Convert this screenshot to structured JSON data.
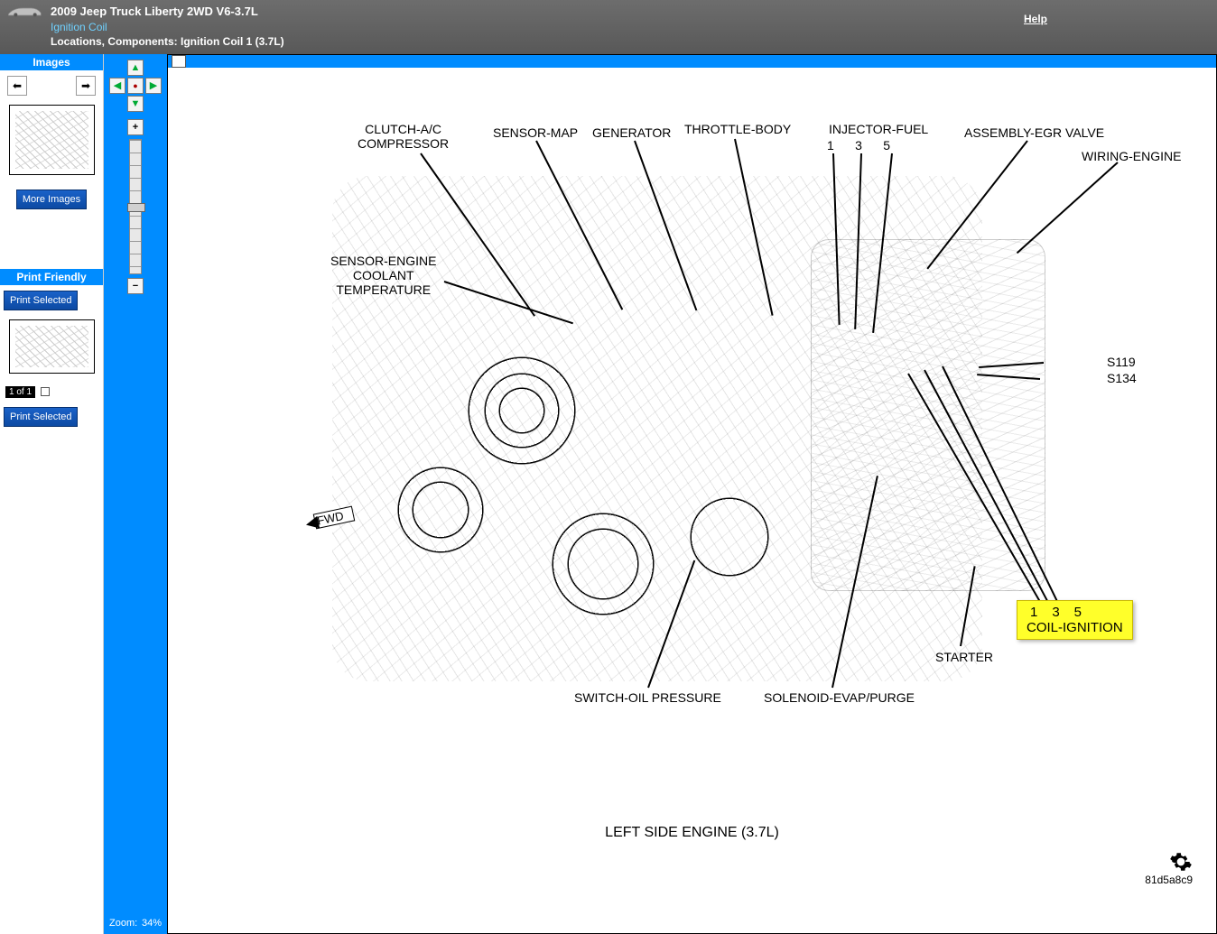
{
  "header": {
    "vehicle": "2009 Jeep Truck Liberty 2WD V6-3.7L",
    "component": "Ignition Coil",
    "breadcrumb": "Locations, Components: Ignition Coil 1 (3.7L)",
    "help": "Help"
  },
  "sidebar": {
    "images_header": "Images",
    "more_images": "More Images",
    "print_header": "Print Friendly",
    "print_selected": "Print Selected",
    "page_indicator": "1 of 1"
  },
  "zoom": {
    "label": "Zoom:",
    "value": "34%"
  },
  "diagram": {
    "subtitle": "LEFT SIDE ENGINE  (3.7L)",
    "doc_id": "81d5a8c9",
    "fwd": "FWD",
    "highlight": {
      "nums": "135",
      "label": "COIL-IGNITION"
    },
    "callouts": [
      {
        "id": "clutch",
        "text": "CLUTCH-A/C\nCOMPRESSOR"
      },
      {
        "id": "map",
        "text": "SENSOR-MAP"
      },
      {
        "id": "gen",
        "text": "GENERATOR"
      },
      {
        "id": "throttle",
        "text": "THROTTLE-BODY"
      },
      {
        "id": "injector",
        "text": "INJECTOR-FUEL"
      },
      {
        "id": "injnums",
        "text": "1      3      5"
      },
      {
        "id": "egr",
        "text": "ASSEMBLY-EGR VALVE"
      },
      {
        "id": "wiring",
        "text": "WIRING-ENGINE"
      },
      {
        "id": "ect",
        "text": "SENSOR-ENGINE\nCOOLANT\nTEMPERATURE"
      },
      {
        "id": "s119",
        "text": "S119"
      },
      {
        "id": "s134",
        "text": "S134"
      },
      {
        "id": "starter",
        "text": "STARTER"
      },
      {
        "id": "oilsw",
        "text": "SWITCH-OIL PRESSURE"
      },
      {
        "id": "evap",
        "text": "SOLENOID-EVAP/PURGE"
      }
    ]
  }
}
